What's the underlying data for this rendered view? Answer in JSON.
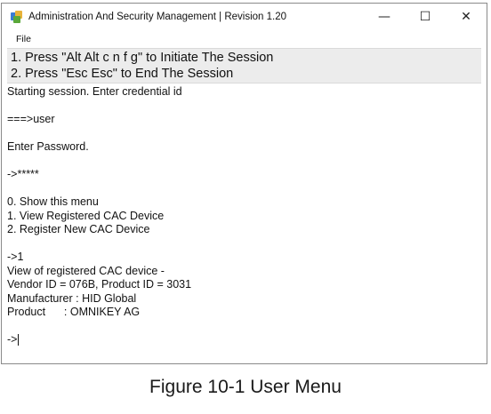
{
  "window": {
    "title": "Administration And Security Management | Revision 1.20",
    "controls": {
      "minimize": "—",
      "maximize": "☐",
      "close": "✕"
    }
  },
  "menu": {
    "items": [
      {
        "label": "File"
      }
    ]
  },
  "banner": {
    "lines": [
      "1. Press \"Alt Alt c n f g\" to Initiate The Session",
      "2. Press \"Esc Esc\" to End The Session"
    ]
  },
  "console": {
    "session_start": "Starting session. Enter credential id",
    "user_entry": "===>user",
    "password_prompt": "Enter Password.",
    "password_entry": "->*****",
    "menu_options": [
      "0. Show this menu",
      "1. View Registered CAC Device",
      "2. Register New CAC Device"
    ],
    "selection_entry": "->1",
    "device_header": "View of registered CAC device -",
    "device_ids": "Vendor ID = 076B, Product ID = 3031",
    "manufacturer": "Manufacturer : HID Global",
    "product": "Product      : OMNIKEY AG",
    "prompt": "->"
  },
  "caption": "Figure 10-1 User Menu"
}
